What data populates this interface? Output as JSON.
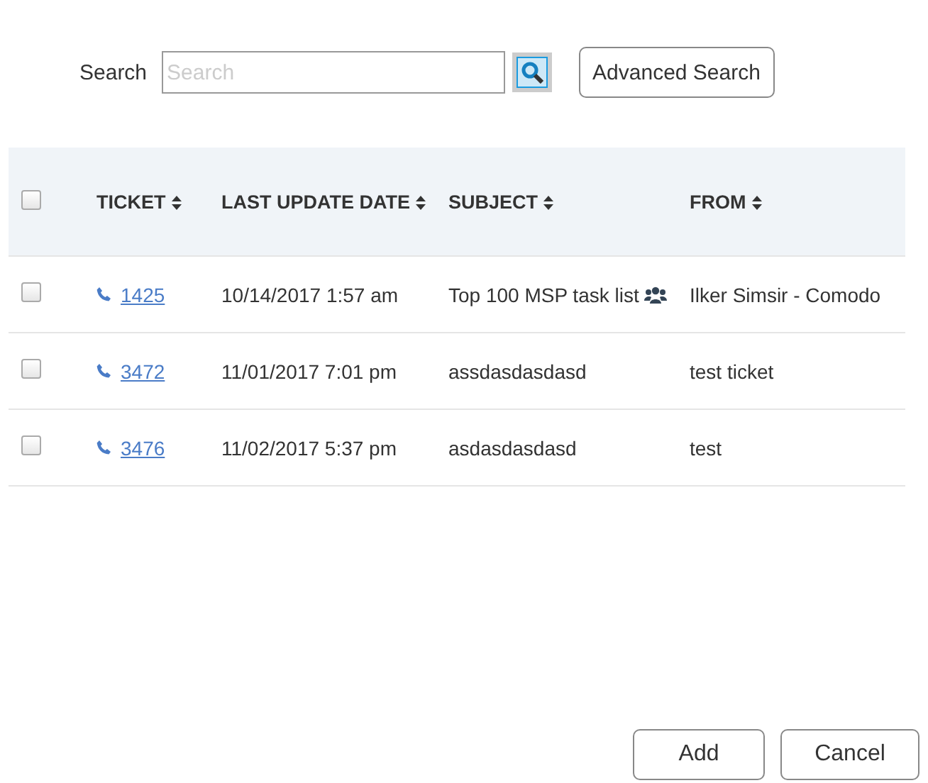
{
  "search": {
    "label": "Search",
    "placeholder": "Search",
    "advanced_button": "Advanced Search"
  },
  "table": {
    "select_all": {
      "checked": false
    },
    "columns": [
      "TICKET",
      "LAST UPDATE DATE",
      "SUBJECT",
      "FROM"
    ],
    "rows": [
      {
        "checked": false,
        "ticket": "1425",
        "date": "10/14/2017 1:57 am",
        "subject": "Top 100 MSP task list",
        "group_icon": true,
        "from": "Ilker Simsir - Comodo"
      },
      {
        "checked": false,
        "ticket": "3472",
        "date": "11/01/2017 7:01 pm",
        "subject": "assdasdasdasd",
        "group_icon": false,
        "from": "test ticket"
      },
      {
        "checked": false,
        "ticket": "3476",
        "date": "11/02/2017 5:37 pm",
        "subject": "asdasdasdasd",
        "group_icon": false,
        "from": "test"
      }
    ]
  },
  "buttons": [
    "Add",
    "Cancel"
  ]
}
